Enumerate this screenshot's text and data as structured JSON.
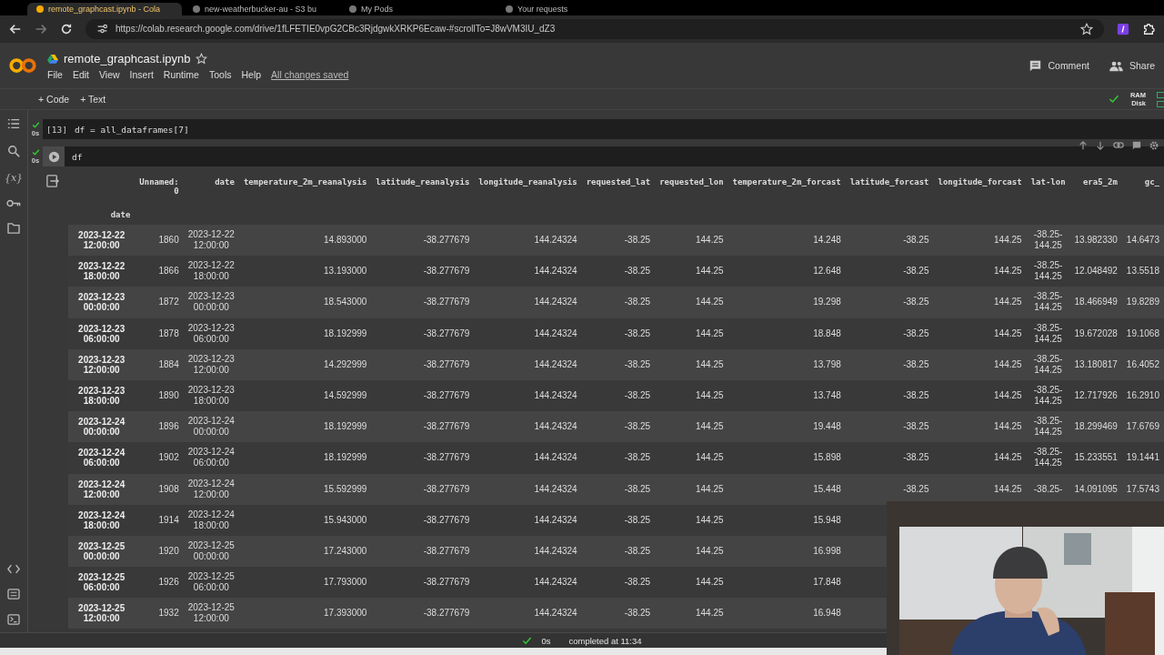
{
  "browser": {
    "tabs": [
      {
        "title": "remote_graphcast.ipynb - Cola",
        "selected": true
      },
      {
        "title": "new-weatherbucker-au - S3 bu",
        "selected": false
      },
      {
        "title": "My Pods",
        "selected": false
      },
      {
        "title": "Your requests",
        "selected": false
      }
    ],
    "url": "https://colab.research.google.com/drive/1fLFETIE0vpG2CBc3RjdgwkXRKP6Ecaw-#scrollTo=J8wVM3IU_dZ3"
  },
  "notebook": {
    "title": "remote_graphcast.ipynb",
    "menu": [
      "File",
      "Edit",
      "View",
      "Insert",
      "Runtime",
      "Tools",
      "Help"
    ],
    "save_status": "All changes saved",
    "actions": [
      "Comment",
      "Share"
    ],
    "toolbar": [
      "+ Code",
      "+ Text"
    ],
    "resources": [
      "RAM",
      "Disk"
    ]
  },
  "rail": {
    "variables_icon": "{x}"
  },
  "cells": [
    {
      "exec_count": "[13]",
      "status": "0s",
      "code": "df = all_dataframes[7]"
    },
    {
      "status": "0s",
      "code": "df"
    }
  ],
  "table": {
    "index_name": "date",
    "columns": [
      "Unnamed:\n0",
      "date",
      "temperature_2m_reanalysis",
      "latitude_reanalysis",
      "longitude_reanalysis",
      "requested_lat",
      "requested_lon",
      "temperature_2m_forcast",
      "latitude_forcast",
      "longitude_forcast",
      "lat-lon",
      "era5_2m",
      "gc_"
    ],
    "rows": [
      {
        "index": "2023-12-22\n12:00:00",
        "cells": [
          "1860",
          "2023-12-22\n12:00:00",
          "14.893000",
          "-38.277679",
          "144.24324",
          "-38.25",
          "144.25",
          "14.248",
          "-38.25",
          "144.25",
          "-38.25-\n144.25",
          "13.982330",
          "14.6473"
        ]
      },
      {
        "index": "2023-12-22\n18:00:00",
        "cells": [
          "1866",
          "2023-12-22\n18:00:00",
          "13.193000",
          "-38.277679",
          "144.24324",
          "-38.25",
          "144.25",
          "12.648",
          "-38.25",
          "144.25",
          "-38.25-\n144.25",
          "12.048492",
          "13.5518"
        ]
      },
      {
        "index": "2023-12-23\n00:00:00",
        "cells": [
          "1872",
          "2023-12-23\n00:00:00",
          "18.543000",
          "-38.277679",
          "144.24324",
          "-38.25",
          "144.25",
          "19.298",
          "-38.25",
          "144.25",
          "-38.25-\n144.25",
          "18.466949",
          "19.8289"
        ]
      },
      {
        "index": "2023-12-23\n06:00:00",
        "cells": [
          "1878",
          "2023-12-23\n06:00:00",
          "18.192999",
          "-38.277679",
          "144.24324",
          "-38.25",
          "144.25",
          "18.848",
          "-38.25",
          "144.25",
          "-38.25-\n144.25",
          "19.672028",
          "19.1068"
        ]
      },
      {
        "index": "2023-12-23\n12:00:00",
        "cells": [
          "1884",
          "2023-12-23\n12:00:00",
          "14.292999",
          "-38.277679",
          "144.24324",
          "-38.25",
          "144.25",
          "13.798",
          "-38.25",
          "144.25",
          "-38.25-\n144.25",
          "13.180817",
          "16.4052"
        ]
      },
      {
        "index": "2023-12-23\n18:00:00",
        "cells": [
          "1890",
          "2023-12-23\n18:00:00",
          "14.592999",
          "-38.277679",
          "144.24324",
          "-38.25",
          "144.25",
          "13.748",
          "-38.25",
          "144.25",
          "-38.25-\n144.25",
          "12.717926",
          "16.2910"
        ]
      },
      {
        "index": "2023-12-24\n00:00:00",
        "cells": [
          "1896",
          "2023-12-24\n00:00:00",
          "18.192999",
          "-38.277679",
          "144.24324",
          "-38.25",
          "144.25",
          "19.448",
          "-38.25",
          "144.25",
          "-38.25-\n144.25",
          "18.299469",
          "17.6769"
        ]
      },
      {
        "index": "2023-12-24\n06:00:00",
        "cells": [
          "1902",
          "2023-12-24\n06:00:00",
          "18.192999",
          "-38.277679",
          "144.24324",
          "-38.25",
          "144.25",
          "15.898",
          "-38.25",
          "144.25",
          "-38.25-\n144.25",
          "15.233551",
          "19.1441"
        ]
      },
      {
        "index": "2023-12-24\n12:00:00",
        "cells": [
          "1908",
          "2023-12-24\n12:00:00",
          "15.592999",
          "-38.277679",
          "144.24324",
          "-38.25",
          "144.25",
          "15.448",
          "-38.25",
          "144.25",
          "-38.25-",
          "14.091095",
          "17.5743"
        ]
      },
      {
        "index": "2023-12-24\n18:00:00",
        "cells": [
          "1914",
          "2023-12-24\n18:00:00",
          "15.943000",
          "-38.277679",
          "144.24324",
          "-38.25",
          "144.25",
          "15.948"
        ]
      },
      {
        "index": "2023-12-25\n00:00:00",
        "cells": [
          "1920",
          "2023-12-25\n00:00:00",
          "17.243000",
          "-38.277679",
          "144.24324",
          "-38.25",
          "144.25",
          "16.998"
        ]
      },
      {
        "index": "2023-12-25\n06:00:00",
        "cells": [
          "1926",
          "2023-12-25\n06:00:00",
          "17.793000",
          "-38.277679",
          "144.24324",
          "-38.25",
          "144.25",
          "17.848"
        ]
      },
      {
        "index": "2023-12-25\n12:00:00",
        "cells": [
          "1932",
          "2023-12-25\n12:00:00",
          "17.393000",
          "-38.277679",
          "144.24324",
          "-38.25",
          "144.25",
          "16.948"
        ]
      }
    ]
  },
  "status_bar": {
    "duration": "0s",
    "message": "completed at 11:34"
  }
}
